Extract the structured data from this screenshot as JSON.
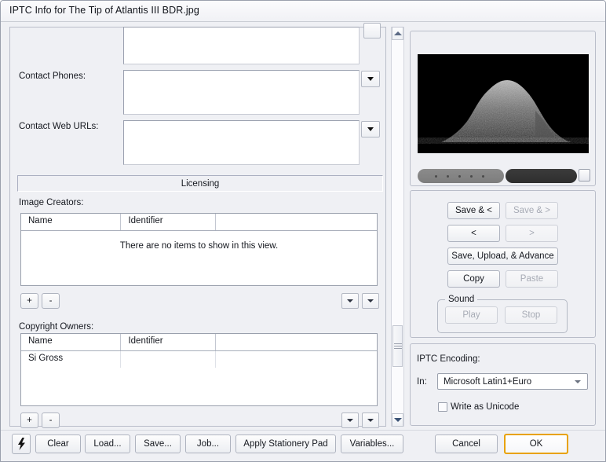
{
  "window": {
    "title": "IPTC Info for The Tip of Atlantis III BDR.jpg"
  },
  "form": {
    "labels": {
      "contact_phones": "Contact Phones:",
      "contact_web_urls": "Contact Web URLs:",
      "image_creators": "Image Creators:",
      "copyright_owners": "Copyright Owners:"
    },
    "fields": {
      "contact_addresses_value": "",
      "contact_phones_value": "",
      "contact_web_urls_value": ""
    },
    "section_bar": {
      "label": "Licensing"
    },
    "image_creators_table": {
      "columns": [
        "Name",
        "Identifier",
        ""
      ],
      "rows": [],
      "empty_message": "There are no items to show in this view."
    },
    "copyright_owners_table": {
      "columns": [
        "Name",
        "Identifier",
        ""
      ],
      "rows": [
        {
          "name": "Si Gross",
          "identifier": "",
          "extra": ""
        }
      ]
    },
    "list_controls": {
      "add": "+",
      "remove": "-"
    }
  },
  "preview": {
    "thumbnail_alt": "dark rocky island thumbnail",
    "filmstrip_dots": 5
  },
  "navigation": {
    "save_and_prev": "Save & <",
    "save_and_next": "Save & >",
    "prev": "<",
    "next": ">",
    "save_upload_advance": "Save, Upload, & Advance",
    "copy": "Copy",
    "paste": "Paste",
    "sound_group": "Sound",
    "play": "Play",
    "stop": "Stop"
  },
  "encoding": {
    "title": "IPTC Encoding:",
    "in_label": "In:",
    "selected": "Microsoft Latin1+Euro",
    "options": [
      "Microsoft Latin1+Euro"
    ],
    "write_as_unicode": "Write as Unicode",
    "write_as_unicode_checked": false
  },
  "footer": {
    "lightning": "⚡",
    "clear": "Clear",
    "load": "Load...",
    "save": "Save...",
    "job": "Job...",
    "apply_stationery_pad": "Apply Stationery Pad",
    "variables": "Variables...",
    "cancel": "Cancel",
    "ok": "OK"
  },
  "colors": {
    "background": "#eff0f4",
    "default_button_border": "#e8a200",
    "text": "#15181f"
  }
}
